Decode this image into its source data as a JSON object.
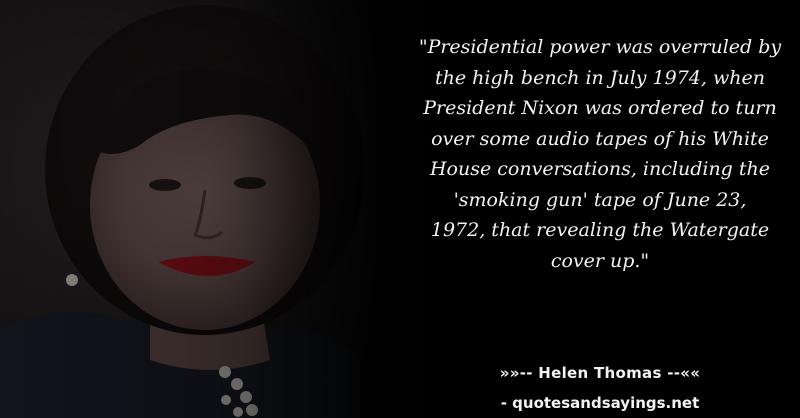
{
  "quote": {
    "lines": [
      "\"Presidential power was overruled by",
      "the high bench in July 1974, when",
      "President Nixon was ordered to turn",
      "over some audio tapes of his White",
      "House conversations, including the",
      "'smoking gun' tape of June 23,",
      "1972, that revealing the Watergate",
      "cover up.\""
    ]
  },
  "attribution": {
    "author": "»»-- Helen Thomas --««",
    "site": "- quotesandsayings.net"
  },
  "colors": {
    "background": "#000000",
    "text": "#f2f2f2"
  }
}
